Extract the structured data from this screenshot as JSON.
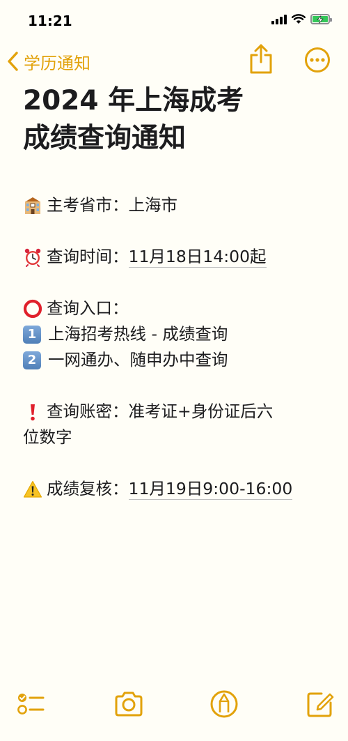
{
  "status_bar": {
    "time": "11:21",
    "battery_charging": true
  },
  "nav": {
    "back_label": "学历通知",
    "accent_color": "#E2A20B"
  },
  "note": {
    "title_line1": "2024 年上海成考",
    "title_line2": "成绩查询通知",
    "line1_label": "主考省市：",
    "line1_value": "上海市",
    "line2_label": "查询时间：",
    "line2_value": "11月18日14:00起",
    "line3_label": "查询入口：",
    "item1_num": "1",
    "item1_text": "上海招考热线 - 成绩查询",
    "item2_num": "2",
    "item2_text": "一网通办、随申办中查询",
    "line4_label": "查询账密：",
    "line4_value_a": "准考证+身份证后六",
    "line4_value_b": "位数字",
    "line5_label": "成绩复核：",
    "line5_value": "11月19日9:00-16:00"
  },
  "icons": {
    "line1": "school-building-icon",
    "line2": "alarm-clock-icon",
    "line3": "red-circle-icon",
    "line4": "exclamation-icon",
    "line5": "warning-icon"
  },
  "toolbar": [
    "checklist-icon",
    "camera-icon",
    "markup-icon",
    "compose-icon"
  ]
}
